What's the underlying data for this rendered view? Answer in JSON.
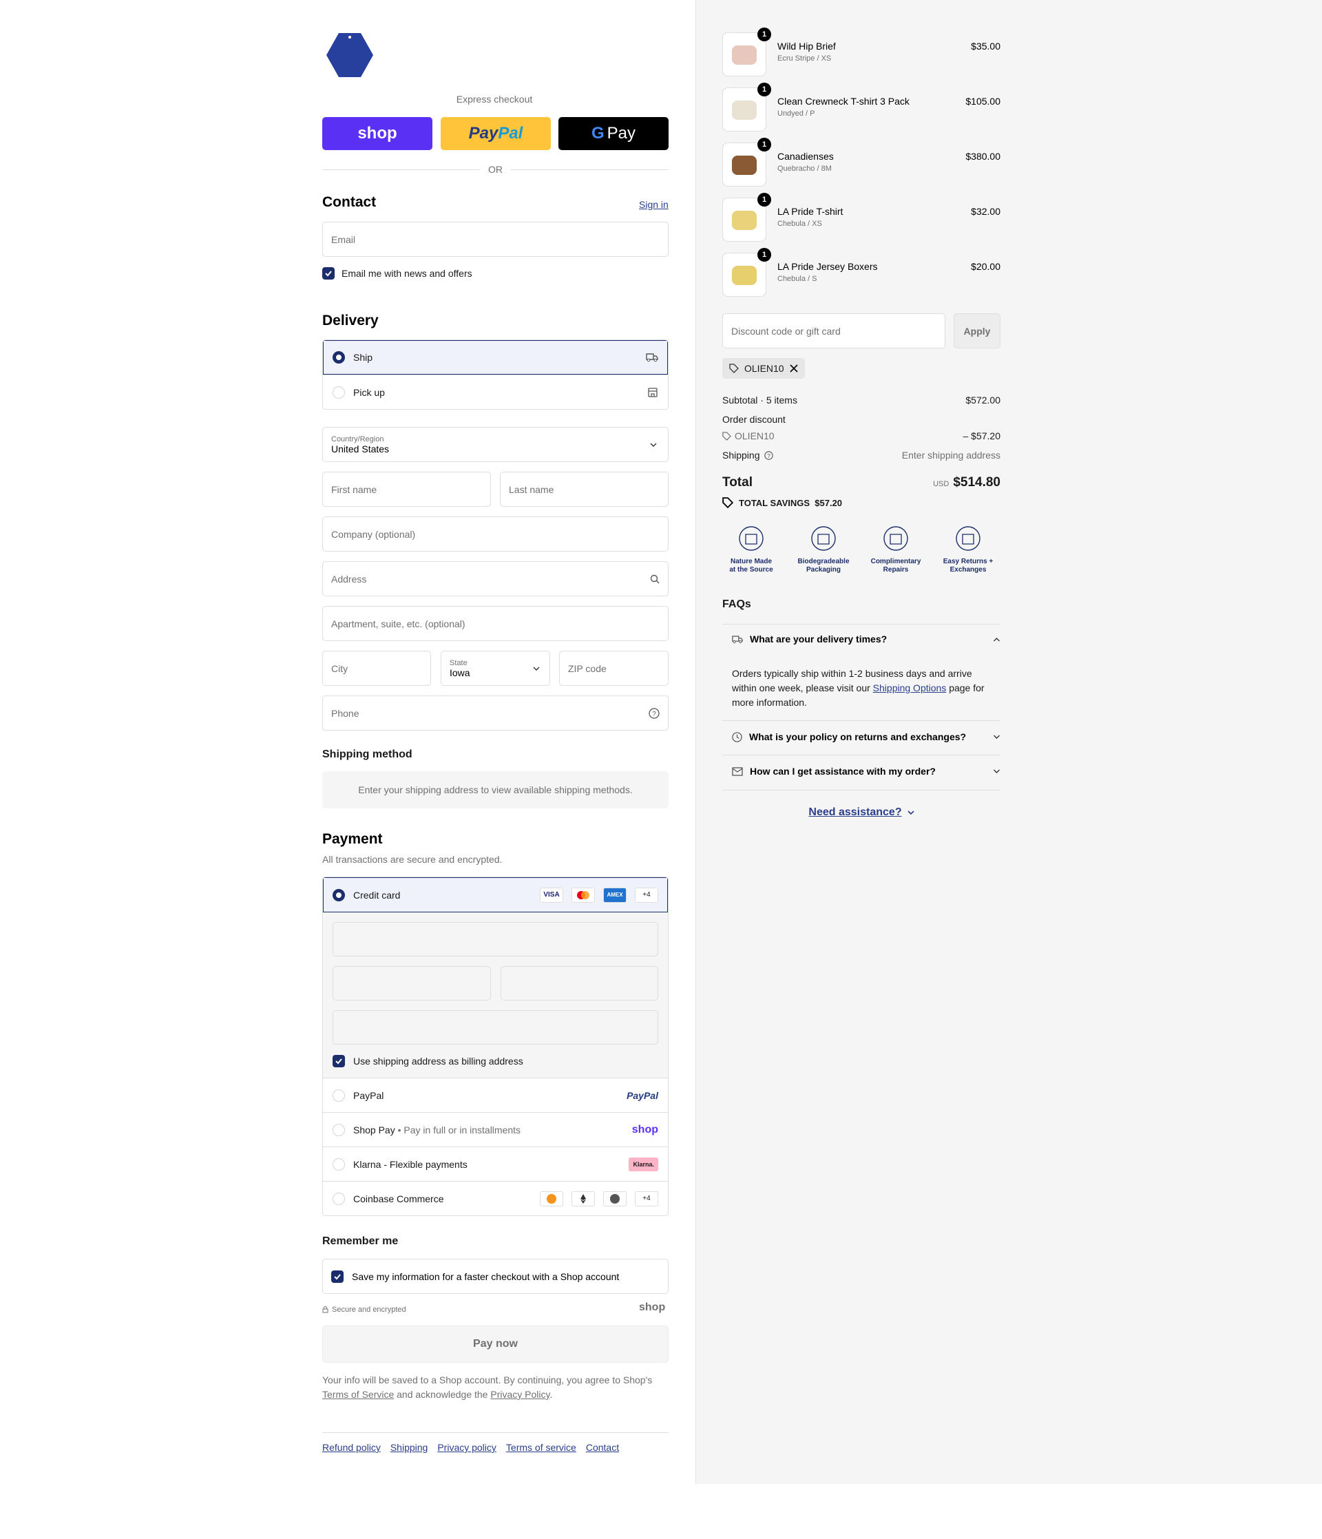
{
  "express": {
    "label": "Express checkout",
    "shop": "shop",
    "paypal": "PayPal",
    "gpay": "Pay",
    "or": "OR"
  },
  "contact": {
    "title": "Contact",
    "signin": "Sign in",
    "email_placeholder": "Email",
    "news_label": "Email me with news and offers"
  },
  "delivery": {
    "title": "Delivery",
    "options": [
      {
        "label": "Ship",
        "selected": true
      },
      {
        "label": "Pick up",
        "selected": false
      }
    ],
    "country_label": "Country/Region",
    "country_value": "United States",
    "first_name": "First name",
    "last_name": "Last name",
    "company": "Company (optional)",
    "address": "Address",
    "apartment": "Apartment, suite, etc. (optional)",
    "city": "City",
    "state_label": "State",
    "state_value": "Iowa",
    "zip": "ZIP code",
    "phone": "Phone"
  },
  "shipping_method": {
    "title": "Shipping method",
    "note": "Enter your shipping address to view available shipping methods."
  },
  "payment": {
    "title": "Payment",
    "subtitle": "All transactions are secure and encrypted.",
    "credit_card": "Credit card",
    "card_more": "+4",
    "billing_label": "Use shipping address as billing address",
    "paypal": "PayPal",
    "paypal_logo": "PayPal",
    "shoppay": "Shop Pay",
    "shoppay_sub": "Pay in full or in installments",
    "shoppay_logo": "shop",
    "klarna": "Klarna - Flexible payments",
    "klarna_logo": "Klarna.",
    "coinbase": "Coinbase Commerce",
    "coin_more": "+4"
  },
  "remember": {
    "title": "Remember me",
    "save_label": "Save my information for a faster checkout with a Shop account",
    "secure": "Secure and encrypted",
    "shop_logo": "shop"
  },
  "pay_now": "Pay now",
  "legal": {
    "text1": "Your info will be saved to a Shop account. By continuing, you agree to Shop's",
    "tos": "Terms of Service",
    "text2": "and acknowledge the",
    "privacy": "Privacy Policy",
    "end": "."
  },
  "footer_links": [
    "Refund policy",
    "Shipping",
    "Privacy policy",
    "Terms of service",
    "Contact"
  ],
  "cart": {
    "items": [
      {
        "name": "Wild Hip Brief",
        "variant": "Ecru Stripe / XS",
        "price": "$35.00",
        "qty": "1",
        "color": "#e8c7bd"
      },
      {
        "name": "Clean Crewneck T-shirt 3 Pack",
        "variant": "Undyed / P",
        "price": "$105.00",
        "qty": "1",
        "color": "#e9e2d3"
      },
      {
        "name": "Canadienses",
        "variant": "Quebracho / 8M",
        "price": "$380.00",
        "qty": "1",
        "color": "#8a5a34"
      },
      {
        "name": "LA Pride T-shirt",
        "variant": "Chebula / XS",
        "price": "$32.00",
        "qty": "1",
        "color": "#ead27a"
      },
      {
        "name": "LA Pride Jersey Boxers",
        "variant": "Chebula / S",
        "price": "$20.00",
        "qty": "1",
        "color": "#e8cf6e"
      }
    ],
    "discount_placeholder": "Discount code or gift card",
    "apply": "Apply",
    "code": "OLIEN10",
    "subtotal_label": "Subtotal · 5 items",
    "subtotal": "$572.00",
    "order_discount": "Order discount",
    "discount_code": "OLIEN10",
    "discount_value": "– $57.20",
    "shipping_label": "Shipping",
    "shipping_value": "Enter shipping address",
    "total_label": "Total",
    "currency": "USD",
    "total": "$514.80",
    "savings": "TOTAL SAVINGS  $57.20"
  },
  "features": [
    {
      "line1": "Nature Made",
      "line2": "at the Source"
    },
    {
      "line1": "Biodegradeable",
      "line2": "Packaging"
    },
    {
      "line1": "Complimentary",
      "line2": "Repairs"
    },
    {
      "line1": "Easy Returns +",
      "line2": "Exchanges"
    }
  ],
  "faq": {
    "title": "FAQs",
    "items": [
      {
        "q": "What are your delivery times?",
        "a1": "Orders typically ship within 1-2 business days and arrive within one week, please visit our",
        "link": "Shipping Options",
        "a2": "page for more information."
      },
      {
        "q": "What is your policy on returns and exchanges?"
      },
      {
        "q": "How can I get assistance with my order?"
      }
    ],
    "assist": "Need assistance?"
  },
  "colors": {
    "accent": "#1c2d6b",
    "shop": "#5a31f4",
    "paypal": "#ffc439"
  }
}
